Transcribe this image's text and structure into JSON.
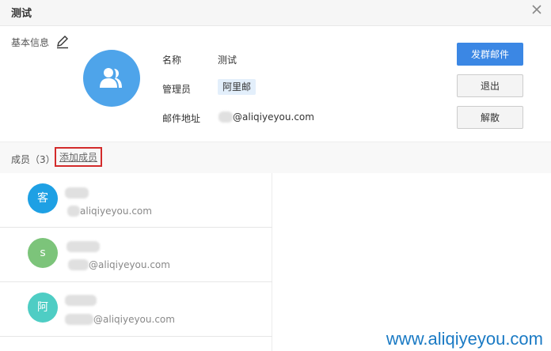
{
  "dialog": {
    "title": "测试"
  },
  "basic_info": {
    "label": "基本信息",
    "fields": {
      "name_label": "名称",
      "name_value": "测试",
      "admin_label": "管理员",
      "admin_value": "阿里邮",
      "email_label": "邮件地址",
      "email_value": "@aliqiyeyou.com"
    }
  },
  "buttons": {
    "send_group_mail": "发群邮件",
    "quit": "退出",
    "dissolve": "解散"
  },
  "members": {
    "label": "成员（3）",
    "add_label": "添加成员",
    "items": [
      {
        "avatar_text": "客",
        "avatar_color": "#1ea0e4",
        "email": "aliqiyeyou.com"
      },
      {
        "avatar_text": "s",
        "avatar_color": "#7cc47a",
        "email": "@aliqiyeyou.com"
      },
      {
        "avatar_text": "阿",
        "avatar_color": "#4ecdc4",
        "email": "@aliqiyeyou.com"
      }
    ]
  },
  "watermark": "www.aliqiyeyou.com",
  "icons": {
    "close": "close-icon",
    "edit": "pencil-icon",
    "group": "group-icon"
  }
}
